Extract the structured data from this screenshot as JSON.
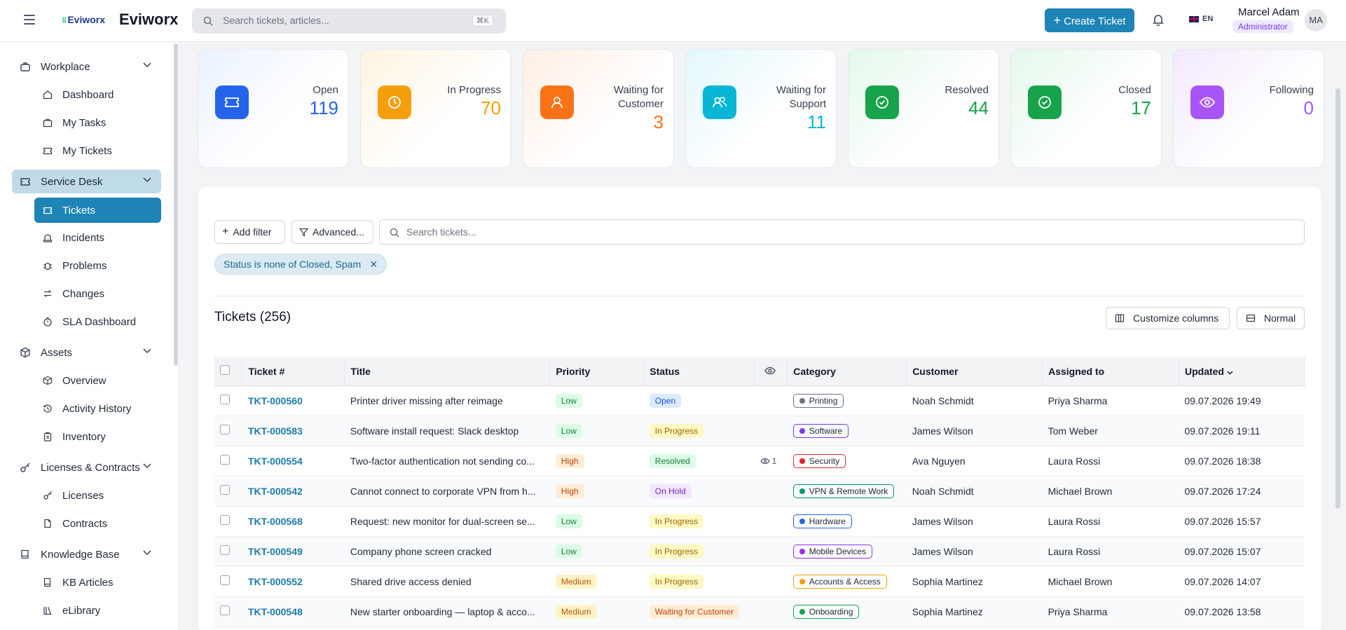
{
  "header": {
    "brand_small": "Eviworx",
    "brand": "Eviworx",
    "search_placeholder": "Search tickets, articles...",
    "search_shortcut": "⌘K",
    "create_label": "Create Ticket",
    "language": "EN",
    "user_name": "Marcel Adam",
    "user_role": "Administrator",
    "avatar_initials": "MA"
  },
  "sidebar": {
    "groups": [
      {
        "label": "Workplace",
        "items": [
          "Dashboard",
          "My Tasks",
          "My Tickets"
        ]
      },
      {
        "label": "Service Desk",
        "items": [
          "Tickets",
          "Incidents",
          "Problems",
          "Changes",
          "SLA Dashboard"
        ]
      },
      {
        "label": "Assets",
        "items": [
          "Overview",
          "Activity History",
          "Inventory"
        ]
      },
      {
        "label": "Licenses & Contracts",
        "items": [
          "Licenses",
          "Contracts"
        ]
      },
      {
        "label": "Knowledge Base",
        "items": [
          "KB Articles",
          "eLibrary"
        ]
      }
    ]
  },
  "stats": [
    {
      "label": "Open",
      "value": "119",
      "color": "#2563eb"
    },
    {
      "label": "In Progress",
      "value": "70",
      "color": "#f59e0b"
    },
    {
      "label": "Waiting for Customer",
      "value": "3",
      "color": "#f97316"
    },
    {
      "label": "Waiting for Support",
      "value": "11",
      "color": "#06b6d4"
    },
    {
      "label": "Resolved",
      "value": "44",
      "color": "#16a34a"
    },
    {
      "label": "Closed",
      "value": "17",
      "color": "#16a34a"
    },
    {
      "label": "Following",
      "value": "0",
      "color": "#a855f7"
    }
  ],
  "filters": {
    "add_filter": "Add filter",
    "advanced": "Advanced...",
    "search_placeholder": "Search tickets...",
    "active_chip": "Status is none of Closed, Spam"
  },
  "list": {
    "title": "Tickets (256)",
    "customize_label": "Customize columns",
    "density_label": "Normal",
    "columns": [
      "Ticket #",
      "Title",
      "Priority",
      "Status",
      "Category",
      "Customer",
      "Assigned to",
      "Updated"
    ],
    "rows": [
      {
        "id": "TKT-000560",
        "title": "Printer driver missing after reimage",
        "priority": "Low",
        "status": "Open",
        "follow": "",
        "category": "Printing",
        "customer": "Noah Schmidt",
        "assigned": "Priya Sharma",
        "updated": "09.07.2026 19:49"
      },
      {
        "id": "TKT-000583",
        "title": "Software install request: Slack desktop",
        "priority": "Low",
        "status": "In Progress",
        "follow": "",
        "category": "Software",
        "customer": "James Wilson",
        "assigned": "Tom Weber",
        "updated": "09.07.2026 19:11"
      },
      {
        "id": "TKT-000554",
        "title": "Two-factor authentication not sending co...",
        "priority": "High",
        "status": "Resolved",
        "follow": "1",
        "category": "Security",
        "customer": "Ava Nguyen",
        "assigned": "Laura Rossi",
        "updated": "09.07.2026 18:38"
      },
      {
        "id": "TKT-000542",
        "title": "Cannot connect to corporate VPN from h...",
        "priority": "High",
        "status": "On Hold",
        "follow": "",
        "category": "VPN & Remote Work",
        "customer": "Noah Schmidt",
        "assigned": "Michael Brown",
        "updated": "09.07.2026 17:24"
      },
      {
        "id": "TKT-000568",
        "title": "Request: new monitor for dual-screen se...",
        "priority": "Low",
        "status": "In Progress",
        "follow": "",
        "category": "Hardware",
        "customer": "James Wilson",
        "assigned": "Laura Rossi",
        "updated": "09.07.2026 15:57"
      },
      {
        "id": "TKT-000549",
        "title": "Company phone screen cracked",
        "priority": "Low",
        "status": "In Progress",
        "follow": "",
        "category": "Mobile Devices",
        "customer": "James Wilson",
        "assigned": "Laura Rossi",
        "updated": "09.07.2026 15:07"
      },
      {
        "id": "TKT-000552",
        "title": "Shared drive access denied",
        "priority": "Medium",
        "status": "In Progress",
        "follow": "",
        "category": "Accounts & Access",
        "customer": "Sophia Martinez",
        "assigned": "Michael Brown",
        "updated": "09.07.2026 14:07"
      },
      {
        "id": "TKT-000548",
        "title": "New starter onboarding — laptop & acco...",
        "priority": "Medium",
        "status": "Waiting for Customer",
        "follow": "",
        "category": "Onboarding",
        "customer": "Sophia Martinez",
        "assigned": "Priya Sharma",
        "updated": "09.07.2026 13:58"
      }
    ]
  }
}
